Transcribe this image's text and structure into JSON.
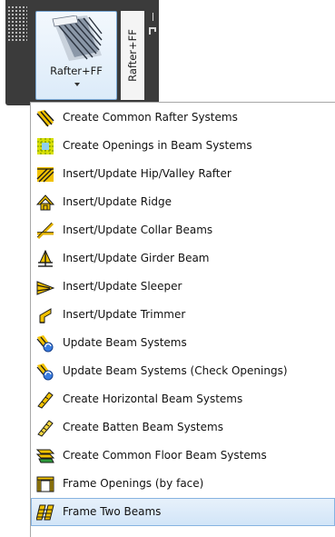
{
  "panel": {
    "button_label": "Rafter+FF",
    "tab_label": "Rafter+FF"
  },
  "menu": {
    "items": [
      {
        "label": "Create Common Rafter Systems",
        "icon": "common-rafter-icon"
      },
      {
        "label": "Create Openings in Beam Systems",
        "icon": "beam-openings-icon"
      },
      {
        "label": "Insert/Update Hip/Valley Rafter",
        "icon": "hip-valley-rafter-icon"
      },
      {
        "label": "Insert/Update Ridge",
        "icon": "ridge-icon"
      },
      {
        "label": "Insert/Update Collar Beams",
        "icon": "collar-beams-icon"
      },
      {
        "label": "Insert/Update Girder Beam",
        "icon": "girder-beam-icon"
      },
      {
        "label": "Insert/Update Sleeper",
        "icon": "sleeper-icon"
      },
      {
        "label": "Insert/Update Trimmer",
        "icon": "trimmer-icon"
      },
      {
        "label": "Update Beam Systems",
        "icon": "update-beam-systems-icon"
      },
      {
        "label": "Update Beam Systems (Check Openings)",
        "icon": "update-beam-systems-check-icon"
      },
      {
        "label": "Create Horizontal Beam Systems",
        "icon": "horizontal-beam-icon"
      },
      {
        "label": "Create Batten Beam Systems",
        "icon": "batten-beam-icon"
      },
      {
        "label": "Create Common Floor Beam Systems",
        "icon": "floor-beam-icon"
      },
      {
        "label": "Frame Openings (by face)",
        "icon": "frame-openings-icon"
      },
      {
        "label": "Frame Two Beams",
        "icon": "frame-two-beams-icon"
      }
    ],
    "highlighted_index": 14,
    "highlight_color": "#d2e5f8",
    "accent_color": "#86b3e0"
  }
}
